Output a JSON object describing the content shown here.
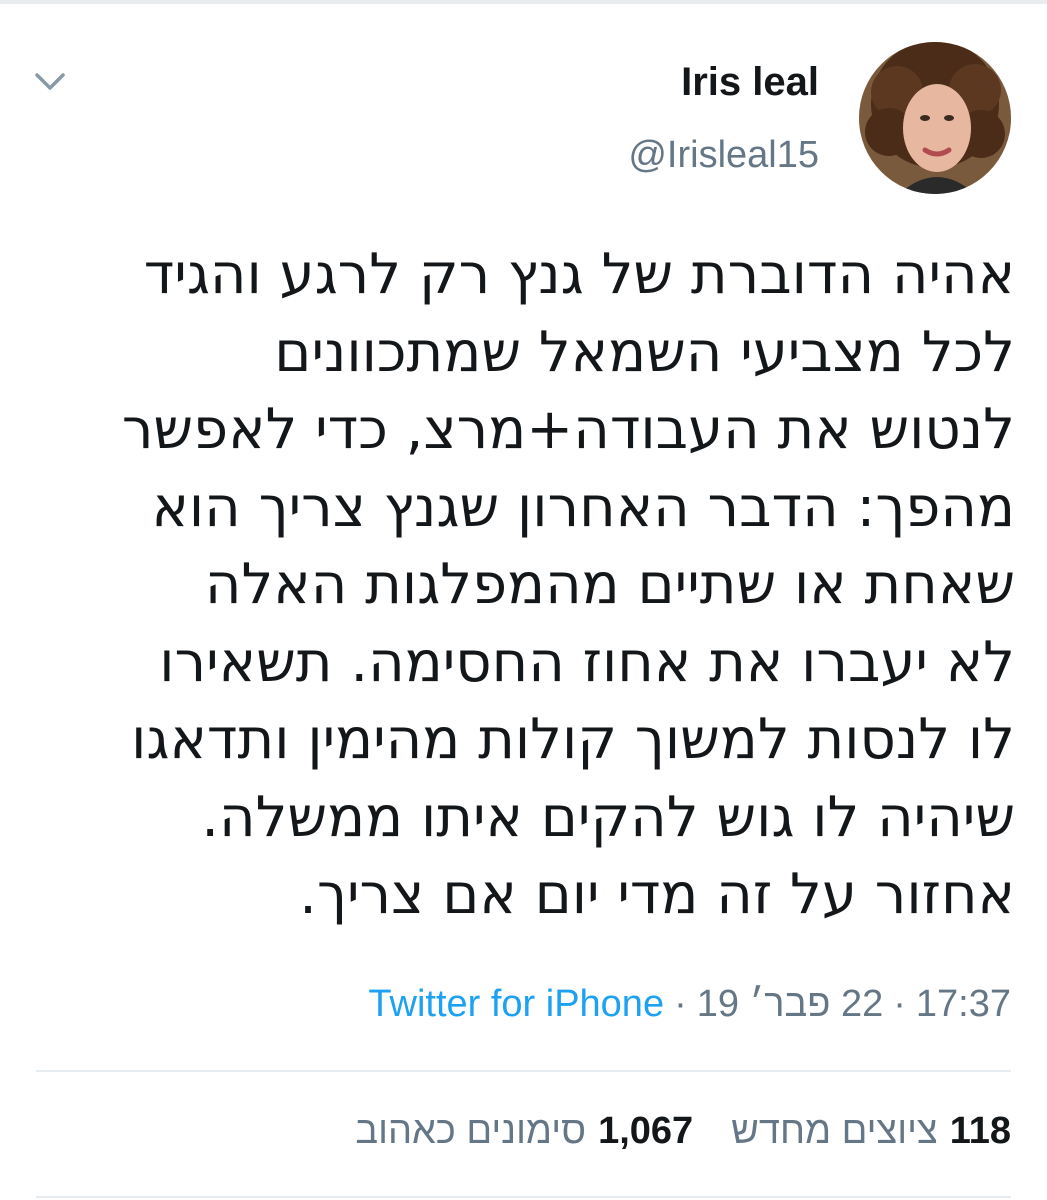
{
  "author": {
    "name": "Iris leal",
    "handle": "@Irisleal15"
  },
  "tweet": {
    "lines": [
      "אהיה הדוברת של גנץ רק לרגע והגיד",
      "לכל מצביעי השמאל שמתכוונים",
      "לנטוש את העבודה+מרצ, כדי לאפשר",
      "מהפך: הדבר האחרון שגנץ צריך הוא",
      "שאחת או שתיים מהמפלגות האלה",
      "לא יעברו את אחוז החסימה. תשאירו",
      "לו לנסות למשוך קולות מהימין ותדאגו",
      "שיהיה לו גוש להקים איתו ממשלה.",
      "אחזור על זה מדי יום אם צריך."
    ]
  },
  "meta": {
    "time": "17:37",
    "date": "22 פבר׳ 19",
    "separator": "·",
    "source": "Twitter for iPhone"
  },
  "stats": {
    "retweets_count": "118",
    "retweets_label": "ציוצים מחדש",
    "likes_count": "1,067",
    "likes_label": "סימונים כאהוב"
  },
  "icons": {
    "chevron": "chevron-down-icon",
    "accent": "#1da1f2",
    "secondary_text": "#657786"
  }
}
